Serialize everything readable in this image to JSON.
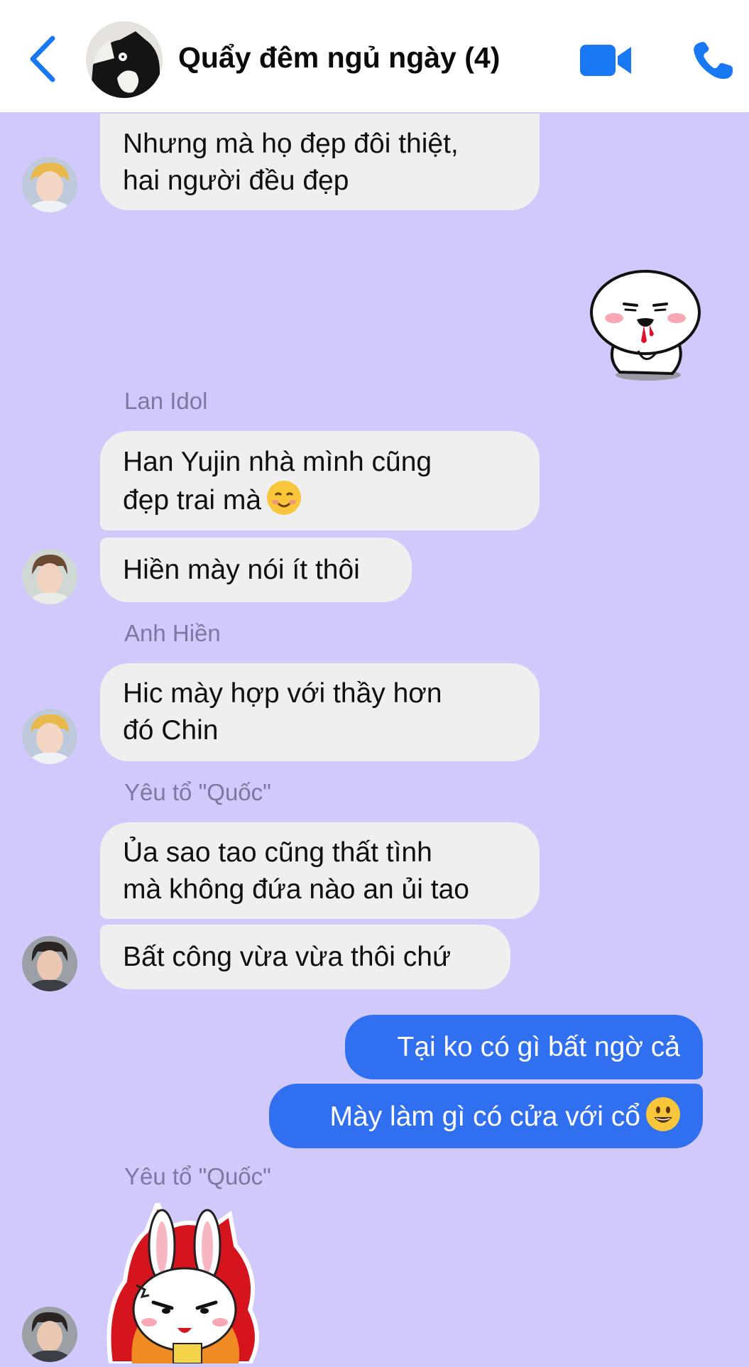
{
  "header": {
    "title": "Quẩy đêm ngủ ngày (4)",
    "icons": [
      "back-icon",
      "video-call-icon",
      "phone-icon"
    ],
    "accent_color": "#1877f2"
  },
  "chat": {
    "background_color": "#d1c9fb",
    "messages": [
      {
        "line1": "Nhưng mà họ đẹp đôi thiệt,",
        "line2": "hai người đều đẹp"
      },
      {
        "sender": "Lan Idol",
        "line1": "Han Yujin nhà mình cũng",
        "line2": "đẹp trai mà",
        "emoji": "smiling-blush-emoji"
      },
      {
        "text": "Hiền mày nói ít thôi"
      },
      {
        "sender": "Anh Hiền",
        "line1": "Hic mày hợp với thầy hơn",
        "line2": "đó Chin"
      },
      {
        "sender": "Yêu tổ \"Quốc\"",
        "line1": "Ủa sao tao cũng thất tình",
        "line2": "mà không đứa nào an ủi tao"
      },
      {
        "text": "Bất công vừa vừa thôi chứ"
      },
      {
        "text": "Tại ko có gì bất ngờ cả"
      },
      {
        "text": "Mày làm gì có cửa với cổ",
        "emoji": "grinning-emoji"
      },
      {
        "sender": "Yêu tổ \"Quốc\""
      }
    ]
  }
}
